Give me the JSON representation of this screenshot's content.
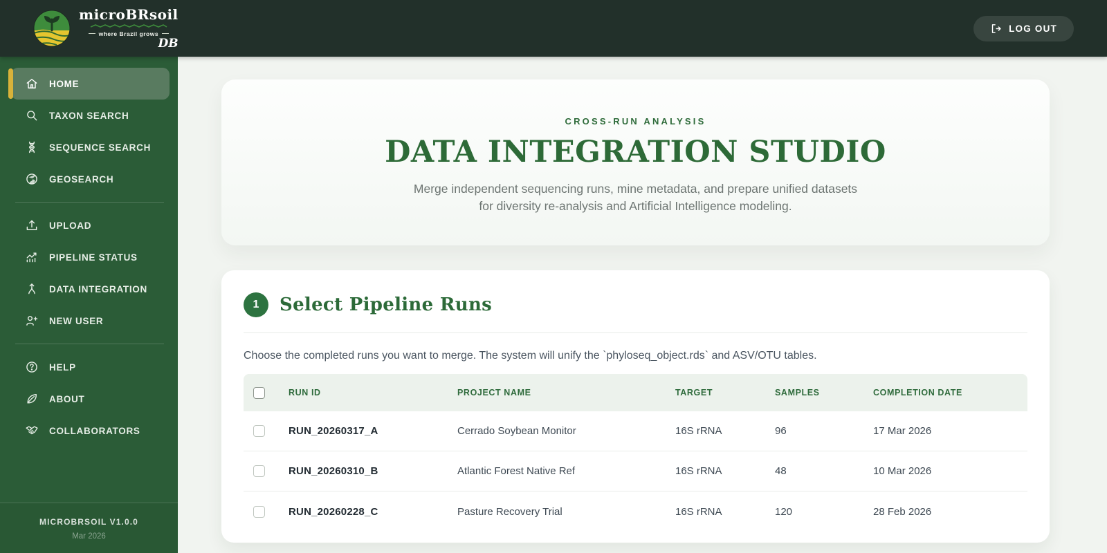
{
  "header": {
    "logo": {
      "name": "microBRsoil",
      "tagline": "where Brazil grows",
      "db_suffix": "DB"
    },
    "logout_button": "LOG OUT"
  },
  "sidebar": {
    "items": [
      {
        "label": "HOME",
        "icon": "home-icon",
        "active": true
      },
      {
        "label": "TAXON SEARCH",
        "icon": "search-icon",
        "active": false
      },
      {
        "label": "SEQUENCE SEARCH",
        "icon": "dna-icon",
        "active": false
      },
      {
        "label": "GEOSEARCH",
        "icon": "globe-icon",
        "active": false
      },
      {
        "label": "UPLOAD",
        "icon": "upload-icon",
        "active": false
      },
      {
        "label": "PIPELINE STATUS",
        "icon": "chart-icon",
        "active": false
      },
      {
        "label": "DATA INTEGRATION",
        "icon": "merge-icon",
        "active": false
      },
      {
        "label": "NEW USER",
        "icon": "user-plus-icon",
        "active": false
      },
      {
        "label": "HELP",
        "icon": "help-icon",
        "active": false
      },
      {
        "label": "ABOUT",
        "icon": "leaf-icon",
        "active": false
      },
      {
        "label": "COLLABORATORS",
        "icon": "handshake-icon",
        "active": false
      }
    ],
    "footer": {
      "version": "MICROBRSOIL V1.0.0",
      "release_date": "Mar 2026"
    }
  },
  "main": {
    "hero": {
      "eyebrow": "CROSS-RUN ANALYSIS",
      "title": "DATA INTEGRATION STUDIO",
      "description": "Merge independent sequencing runs, mine metadata, and prepare unified datasets for diversity re-analysis and Artificial Intelligence modeling."
    },
    "step1": {
      "number": "1",
      "title": "Select Pipeline Runs",
      "description": "Choose the completed runs you want to merge. The system will unify the `phyloseq_object.rds` and ASV/OTU tables.",
      "table": {
        "columns": [
          "RUN ID",
          "PROJECT NAME",
          "TARGET",
          "SAMPLES",
          "COMPLETION DATE"
        ],
        "rows": [
          {
            "run_id": "RUN_20260317_A",
            "project_name": "Cerrado Soybean Monitor",
            "target": "16S rRNA",
            "samples": "96",
            "completion_date": "17 Mar 2026",
            "checked": false
          },
          {
            "run_id": "RUN_20260310_B",
            "project_name": "Atlantic Forest Native Ref",
            "target": "16S rRNA",
            "samples": "48",
            "completion_date": "10 Mar 2026",
            "checked": false
          },
          {
            "run_id": "RUN_20260228_C",
            "project_name": "Pasture Recovery Trial",
            "target": "16S rRNA",
            "samples": "120",
            "completion_date": "28 Feb 2026",
            "checked": false
          }
        ]
      }
    }
  },
  "colors": {
    "header_bg": "#22302a",
    "sidebar_bg": "#2b5c37",
    "active_item_bg": "#597b60",
    "accent_yellow": "#d8b23a",
    "brand_green": "#2d6a37",
    "table_header_bg": "#ecf2ec",
    "page_bg": "#f1f4f0"
  }
}
